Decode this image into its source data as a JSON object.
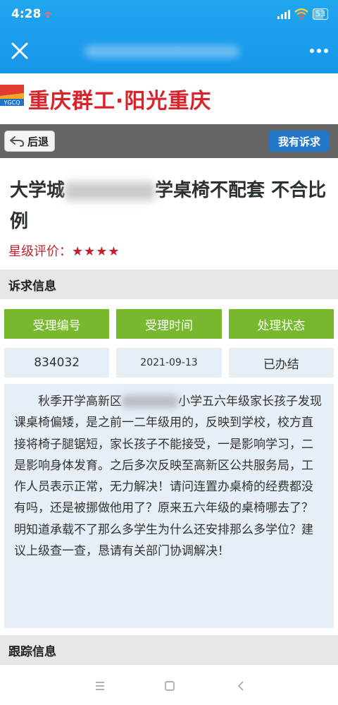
{
  "status_bar": {
    "time": "4:28",
    "battery": "53",
    "battery_level": 0.53
  },
  "app_header": {
    "close_icon": "close-icon",
    "more_icon": "more-icon"
  },
  "site": {
    "logo_text": "YGCQ",
    "name": "重庆群工·阳光重庆",
    "brand_color": "#d8232a"
  },
  "actions": {
    "back_label": "后退",
    "appeal_label": "我有诉求"
  },
  "article": {
    "title_prefix": "大学城",
    "title_suffix": "学桌椅不配套 不合比例",
    "rating_label": "星级评价：",
    "rating_stars": "★★★★",
    "rating_value": 4
  },
  "sections": {
    "info_title": "诉求信息",
    "tracking_title": "跟踪信息"
  },
  "info": {
    "headers": [
      "受理编号",
      "受理时间",
      "处理状态"
    ],
    "values": [
      "834032",
      "2021-09-13",
      "已办结"
    ]
  },
  "content": {
    "part1": "秋季开学高新区",
    "part2": "小学五六年级家长孩子发现课桌椅偏矮，是之前一二年级用的，反映到学校，校方直接将椅子腿锯短，家长孩子不能接受，一是影响学习，二是影响身体发育。之后多次反映至高新区公共服务局，工作人员表示正常，无力解决！请问连置办桌椅的经费都没有吗，还是被挪做他用了？原来五六年级的桌椅哪去了？明知道承载不了那么多学生为什么还安排那么多学位？建议上级查一查，恳请有关部门协调解决！"
  },
  "colors": {
    "header_blue": "#1896ea",
    "green": "#77b82e",
    "light_blue": "#e6eef6",
    "star_red": "#c51f2b"
  }
}
